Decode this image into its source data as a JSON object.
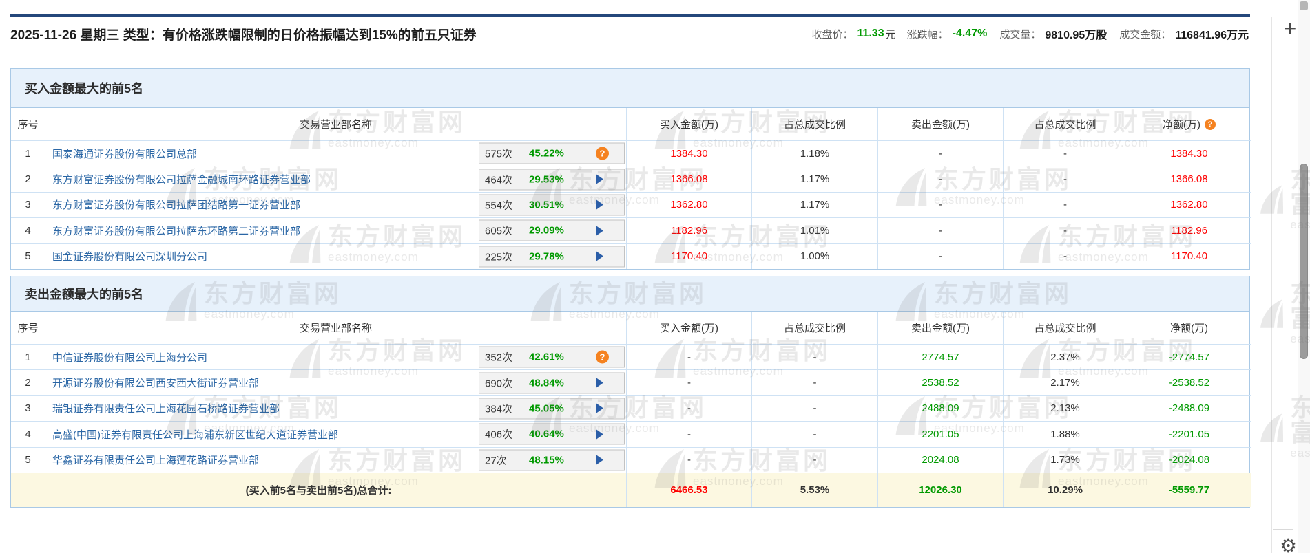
{
  "header": {
    "title": "2025-11-26 星期三 类型：有价格涨跌幅限制的日价格振幅达到15%的前五只证券",
    "stats": [
      {
        "label": "收盘价：",
        "value": "11.33",
        "suffix": "元",
        "color": "green"
      },
      {
        "label": "涨跌幅：",
        "value": "-4.47%",
        "suffix": "",
        "color": "green"
      },
      {
        "label": "成交量：",
        "value": "9810.95万股",
        "suffix": "",
        "color": "dark"
      },
      {
        "label": "成交金额：",
        "value": "116841.96万元",
        "suffix": "",
        "color": "dark"
      }
    ]
  },
  "columns": [
    "序号",
    "交易营业部名称",
    "买入金额(万)",
    "占总成交比例",
    "卖出金额(万)",
    "占总成交比例",
    "净额(万)"
  ],
  "buy_section": {
    "title": "买入金额最大的前5名",
    "net_header_help": true,
    "rows": [
      {
        "no": "1",
        "name": "国泰海通证券股份有限公司总部",
        "trade_count": "575次",
        "amplitude": "45.22%",
        "icon": "help",
        "buy_amount": "1384.30",
        "buy_ratio": "1.18%",
        "sell_amount": "-",
        "sell_ratio": "-",
        "net_amount": "1384.30"
      },
      {
        "no": "2",
        "name": "东方财富证券股份有限公司拉萨金融城南环路证券营业部",
        "trade_count": "464次",
        "amplitude": "29.53%",
        "icon": "arrow",
        "buy_amount": "1366.08",
        "buy_ratio": "1.17%",
        "sell_amount": "-",
        "sell_ratio": "-",
        "net_amount": "1366.08"
      },
      {
        "no": "3",
        "name": "东方财富证券股份有限公司拉萨团结路第一证券营业部",
        "trade_count": "554次",
        "amplitude": "30.51%",
        "icon": "arrow",
        "buy_amount": "1362.80",
        "buy_ratio": "1.17%",
        "sell_amount": "-",
        "sell_ratio": "-",
        "net_amount": "1362.80"
      },
      {
        "no": "4",
        "name": "东方财富证券股份有限公司拉萨东环路第二证券营业部",
        "trade_count": "605次",
        "amplitude": "29.09%",
        "icon": "arrow",
        "buy_amount": "1182.96",
        "buy_ratio": "1.01%",
        "sell_amount": "-",
        "sell_ratio": "-",
        "net_amount": "1182.96"
      },
      {
        "no": "5",
        "name": "国金证券股份有限公司深圳分公司",
        "trade_count": "225次",
        "amplitude": "29.78%",
        "icon": "arrow",
        "buy_amount": "1170.40",
        "buy_ratio": "1.00%",
        "sell_amount": "-",
        "sell_ratio": "-",
        "net_amount": "1170.40"
      }
    ]
  },
  "sell_section": {
    "title": "卖出金额最大的前5名",
    "net_header_help": false,
    "rows": [
      {
        "no": "1",
        "name": "中信证券股份有限公司上海分公司",
        "trade_count": "352次",
        "amplitude": "42.61%",
        "icon": "help",
        "buy_amount": "-",
        "buy_ratio": "-",
        "sell_amount": "2774.57",
        "sell_ratio": "2.37%",
        "net_amount": "-2774.57"
      },
      {
        "no": "2",
        "name": "开源证券股份有限公司西安西大街证券营业部",
        "trade_count": "690次",
        "amplitude": "48.84%",
        "icon": "arrow",
        "buy_amount": "-",
        "buy_ratio": "-",
        "sell_amount": "2538.52",
        "sell_ratio": "2.17%",
        "net_amount": "-2538.52"
      },
      {
        "no": "3",
        "name": "瑞银证券有限责任公司上海花园石桥路证券营业部",
        "trade_count": "384次",
        "amplitude": "45.05%",
        "icon": "arrow",
        "buy_amount": "-",
        "buy_ratio": "-",
        "sell_amount": "2488.09",
        "sell_ratio": "2.13%",
        "net_amount": "-2488.09"
      },
      {
        "no": "4",
        "name": "高盛(中国)证券有限责任公司上海浦东新区世纪大道证券营业部",
        "trade_count": "406次",
        "amplitude": "40.64%",
        "icon": "arrow",
        "buy_amount": "-",
        "buy_ratio": "-",
        "sell_amount": "2201.05",
        "sell_ratio": "1.88%",
        "net_amount": "-2201.05"
      },
      {
        "no": "5",
        "name": "华鑫证券有限责任公司上海莲花路证券营业部",
        "trade_count": "27次",
        "amplitude": "48.15%",
        "icon": "arrow",
        "buy_amount": "-",
        "buy_ratio": "-",
        "sell_amount": "2024.08",
        "sell_ratio": "1.73%",
        "net_amount": "-2024.08"
      }
    ]
  },
  "total": {
    "label": "(买入前5名与卖出前5名)总合计:",
    "buy_amount": "6466.53",
    "buy_ratio": "5.53%",
    "sell_amount": "12026.30",
    "sell_ratio": "10.29%",
    "net_amount": "-5559.77"
  },
  "watermark": {
    "cn": "东方财富网",
    "en": "eastmoney.com"
  },
  "icons": {
    "plus": "+",
    "gear": "⚙",
    "help": "?"
  },
  "colors": {
    "buy_red": "#fe0000",
    "sell_green": "#009900",
    "broker_link_blue": "#2a66a5",
    "section_band_blue": "#e7f1fb",
    "total_row_yellow": "#fcf8e1",
    "top_line_navy": "#24477b",
    "help_icon_orange": "#f58220",
    "arrow_icon_blue": "#2b5ea8"
  }
}
